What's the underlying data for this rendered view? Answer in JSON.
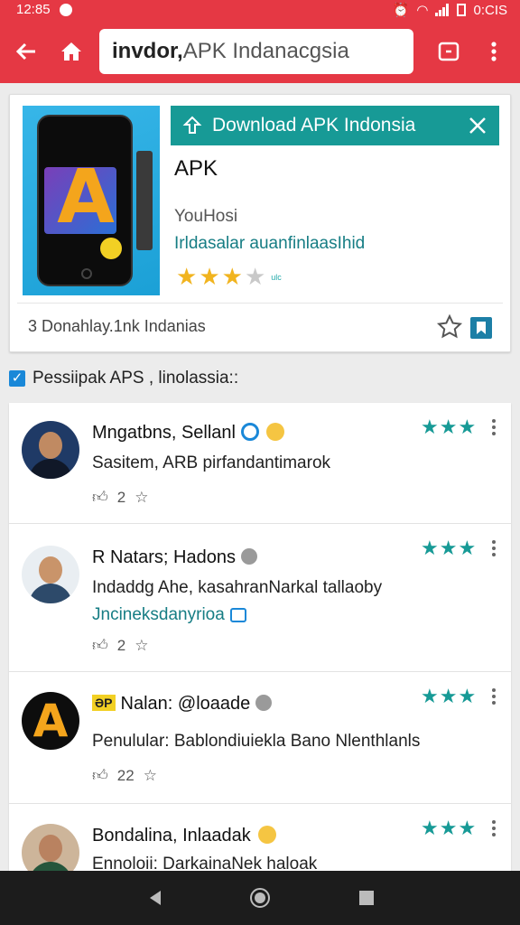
{
  "status_bar": {
    "time": "12:85",
    "right_text": "0:CIS"
  },
  "toolbar": {
    "search_query": "invdor,",
    "search_rest": " APK Indanacgsia"
  },
  "app_card": {
    "banner_label": "Download APK Indonsia",
    "title": "APK",
    "developer": "YouHosi",
    "subtitle": "Irldasalar auanfinlaasIhid",
    "rating_tiny": "ulc",
    "downloads": "3 Donahlay.1nk Indanias"
  },
  "section": {
    "label": "Pessiipak APS , linolassia::"
  },
  "reviews": [
    {
      "name": "Mngatbns, Sellanl",
      "text": "Sasitem, ARB pirfandantimarok",
      "text2": "",
      "likes": "2",
      "stars": "★★★"
    },
    {
      "name": "R Natars; Hadons",
      "text": "Indaddg Ahe, kasahranNarkal tallaoby",
      "text2": "Jncineksdanyrioa",
      "likes": "2",
      "stars": "★★★"
    },
    {
      "name": "Nalan: @loaade",
      "tag": "ƏP",
      "text": "Penulular: Bablondiuiekla Bano Nlenthlanls",
      "text2": "",
      "likes": "22",
      "stars": "★★★"
    },
    {
      "name": "Bondalina, Inlaadak",
      "text": "Ennoloii: DarkainaNek haloak",
      "text2": "",
      "likes": "",
      "stars": "★★★"
    }
  ],
  "colors": {
    "brand_red": "#e53844",
    "teal": "#179a96",
    "star_gold": "#f1b41f"
  }
}
